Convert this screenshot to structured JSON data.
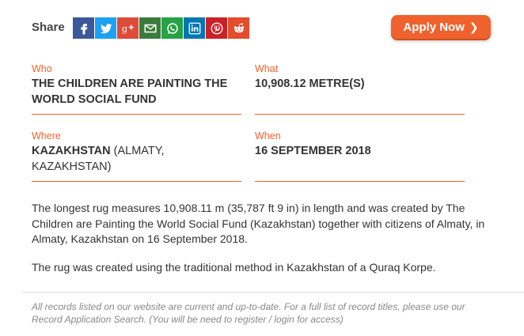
{
  "share": {
    "label": "Share",
    "icons": [
      {
        "name": "facebook-icon",
        "color": "#3b5998"
      },
      {
        "name": "twitter-icon",
        "color": "#1da1f2"
      },
      {
        "name": "google-plus-icon",
        "color": "#dd4b39"
      },
      {
        "name": "email-icon",
        "color": "#3b7a3b"
      },
      {
        "name": "whatsapp-icon",
        "color": "#25a244"
      },
      {
        "name": "linkedin-icon",
        "color": "#0077b5"
      },
      {
        "name": "pinterest-icon",
        "color": "#cb2027"
      },
      {
        "name": "reddit-icon",
        "color": "#e24d2b"
      }
    ]
  },
  "apply_button": {
    "label": "Apply Now",
    "color": "#f0622d"
  },
  "record": {
    "who": {
      "label": "Who",
      "value": "THE CHILDREN ARE PAINTING THE WORLD SOCIAL FUND"
    },
    "what": {
      "label": "What",
      "value": "10,908.12 METRE(S)"
    },
    "where": {
      "label": "Where",
      "country": "KAZAKHSTAN",
      "detail": "(ALMATY, KAZAKHSTAN)"
    },
    "when": {
      "label": "When",
      "value": "16 SEPTEMBER 2018"
    }
  },
  "description": [
    "The longest rug measures 10,908.11 m (35,787 ft 9 in) in length and was created by The Children are Painting the World Social Fund (Kazakhstan) together with citizens of Almaty, in Almaty, Kazakhstan on 16 September 2018.",
    "The rug was created using the traditional method in Kazakhstan of a Quraq Korpe."
  ],
  "footer": "All records listed on our website are current and up-to-date. For a full list of record titles, please use our Record Application Search. (You will be need to register / login for access)",
  "accent_color": "#f0622d"
}
